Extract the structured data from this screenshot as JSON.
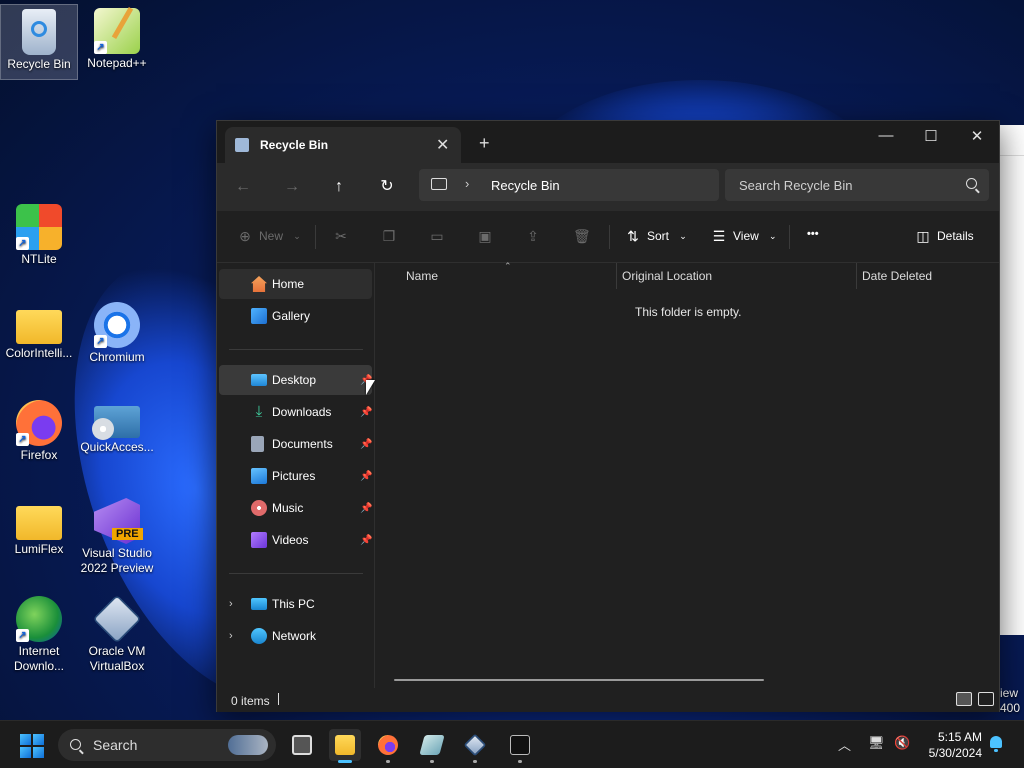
{
  "desktop": {
    "icons": [
      {
        "label": "Recycle Bin",
        "icon": "recycle-bin-icon"
      },
      {
        "label": "Notepad++",
        "icon": "notepadpp-icon"
      },
      {
        "label": "NTLite",
        "icon": "ntlite-icon"
      },
      {
        "label": "ColorIntelli...",
        "icon": "folder-icon"
      },
      {
        "label": "Chromium",
        "icon": "chromium-icon"
      },
      {
        "label": "Firefox",
        "icon": "firefox-icon"
      },
      {
        "label": "QuickAcces...",
        "icon": "quickaccess-icon"
      },
      {
        "label": "LumiFlex",
        "icon": "folder-icon"
      },
      {
        "label": "Visual Studio 2022 Preview",
        "icon": "visual-studio-icon",
        "badge": "PRE"
      },
      {
        "label": "Internet Downlo...",
        "icon": "idm-icon"
      },
      {
        "label": "Oracle VM VirtualBox",
        "icon": "virtualbox-icon"
      }
    ],
    "bleed_text_1": "iew",
    "bleed_text_2": "400"
  },
  "window": {
    "tab_title": "Recycle Bin",
    "new_tab": "+",
    "controls": {
      "minimize": "—",
      "maximize": "☐",
      "close": "✕"
    },
    "address": {
      "back": "←",
      "forward": "→",
      "up": "↑",
      "refresh": "↻",
      "chevron": "›",
      "path": "Recycle Bin",
      "search_placeholder": "Search Recycle Bin"
    },
    "commands": {
      "new": "New",
      "sort": "Sort",
      "view": "View",
      "more": "•••",
      "details": "Details"
    },
    "nav": {
      "home": "Home",
      "gallery": "Gallery",
      "pinned": [
        {
          "label": "Desktop",
          "icon": "desktop-icon"
        },
        {
          "label": "Downloads",
          "icon": "downloads-icon"
        },
        {
          "label": "Documents",
          "icon": "documents-icon"
        },
        {
          "label": "Pictures",
          "icon": "pictures-icon"
        },
        {
          "label": "Music",
          "icon": "music-icon"
        },
        {
          "label": "Videos",
          "icon": "videos-icon"
        }
      ],
      "this_pc": "This PC",
      "network": "Network"
    },
    "columns": [
      "Name",
      "Original Location",
      "Date Deleted"
    ],
    "empty_message": "This folder is empty.",
    "status": {
      "count": "0 items"
    }
  },
  "taskbar": {
    "search_label": "Search",
    "apps": [
      "task-view-icon",
      "file-explorer-icon",
      "firefox-icon",
      "app-icon",
      "virtualbox-icon",
      "terminal-icon"
    ],
    "time": "5:15 AM",
    "date": "5/30/2024"
  },
  "colors": {
    "accent": "#4cc2ff",
    "window_bg": "#202020",
    "toolbar_bg": "#2b2b2b",
    "taskbar_bg": "#1c1c1c"
  }
}
